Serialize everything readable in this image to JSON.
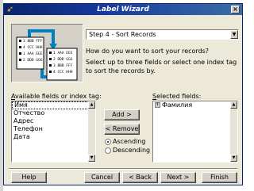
{
  "window": {
    "title": "Label Wizard",
    "close_glyph": "×"
  },
  "illustration": {
    "card_left": {
      "rows": [
        {
          "num": "3",
          "text": "BBB FFF"
        },
        {
          "num": "4",
          "text": "CCC HHH"
        },
        {
          "num": "1",
          "text": "AAA EEE"
        },
        {
          "num": "2",
          "text": "DDD GGG"
        }
      ]
    },
    "card_right": {
      "rows": [
        {
          "num": "1",
          "text": "AAA EEE"
        },
        {
          "num": "2",
          "text": "DDD GGG"
        },
        {
          "num": "3",
          "text": "BBB FFF"
        },
        {
          "num": "4",
          "text": "CCC HHH"
        }
      ]
    },
    "arrow_color": "#0080c0"
  },
  "step": {
    "selected": "Step 4 - Sort Records"
  },
  "instructions": {
    "question": "How do you want to sort your records?",
    "detail": "Select up to three fields or select one index tag to sort the records by."
  },
  "available": {
    "label_accel": "A",
    "label_rest": "vailable fields or index tag:",
    "items": [
      "Имя",
      "Отчество",
      "Адрес",
      "Телефон",
      "Дата"
    ],
    "selected_index": 0
  },
  "selected_fields": {
    "label_accel": "S",
    "label_rest": "elected fields:",
    "items": [
      "Фамилия"
    ]
  },
  "buttons": {
    "add": "Add >",
    "remove": "< Remove",
    "help": "Help",
    "cancel": "Cancel",
    "back": "< Back",
    "next": "Next >",
    "finish": "Finish"
  },
  "order": {
    "ascending": "Ascending",
    "descending": "Descending",
    "selected": "ascending"
  }
}
